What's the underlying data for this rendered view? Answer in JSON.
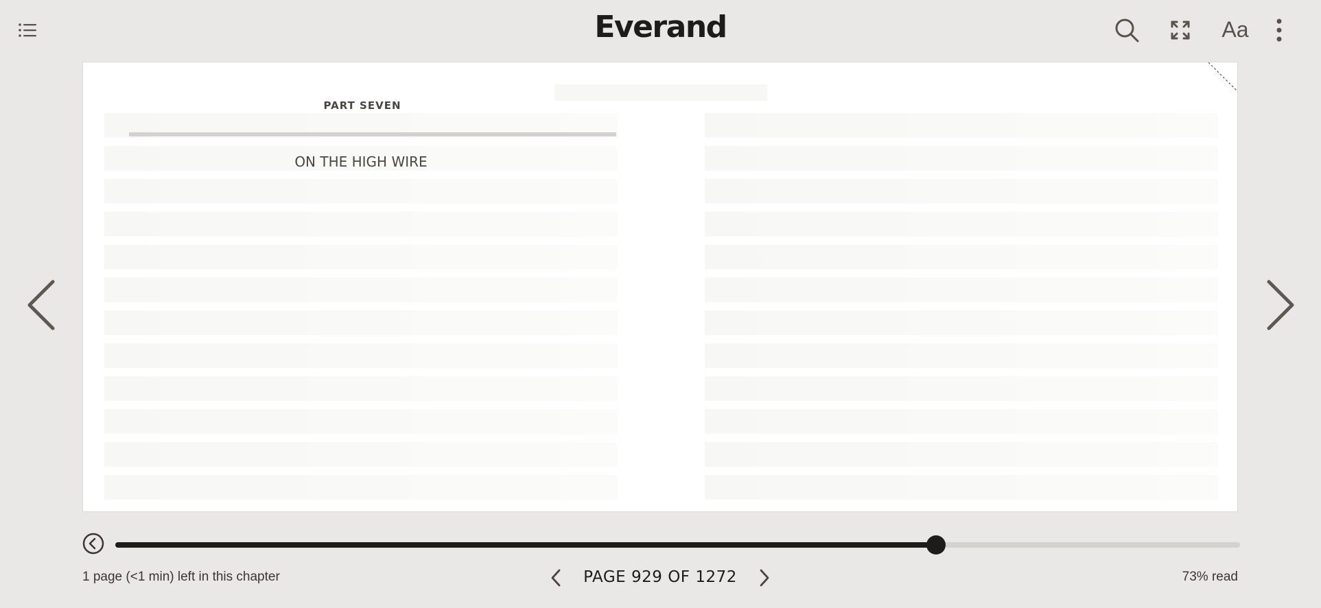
{
  "header": {
    "logo": "Everand",
    "icons": {
      "toc": "table-of-contents-icon",
      "search": "search-icon",
      "fullscreen": "expand-icon",
      "text_settings_label": "Aa",
      "more": "more-vertical-icon"
    }
  },
  "book": {
    "part_label": "PART SEVEN",
    "chapter_title": "ON THE HIGH WIRE"
  },
  "progress": {
    "fraction": 0.73,
    "chapter_remaining": "1 page (<1 min) left in this chapter",
    "page_label": "PAGE 929 OF 1272",
    "percent_read": "73% read"
  },
  "colors": {
    "background": "#e9e8e6",
    "accent": "#1e1c18",
    "track": "#d3d2cf"
  }
}
